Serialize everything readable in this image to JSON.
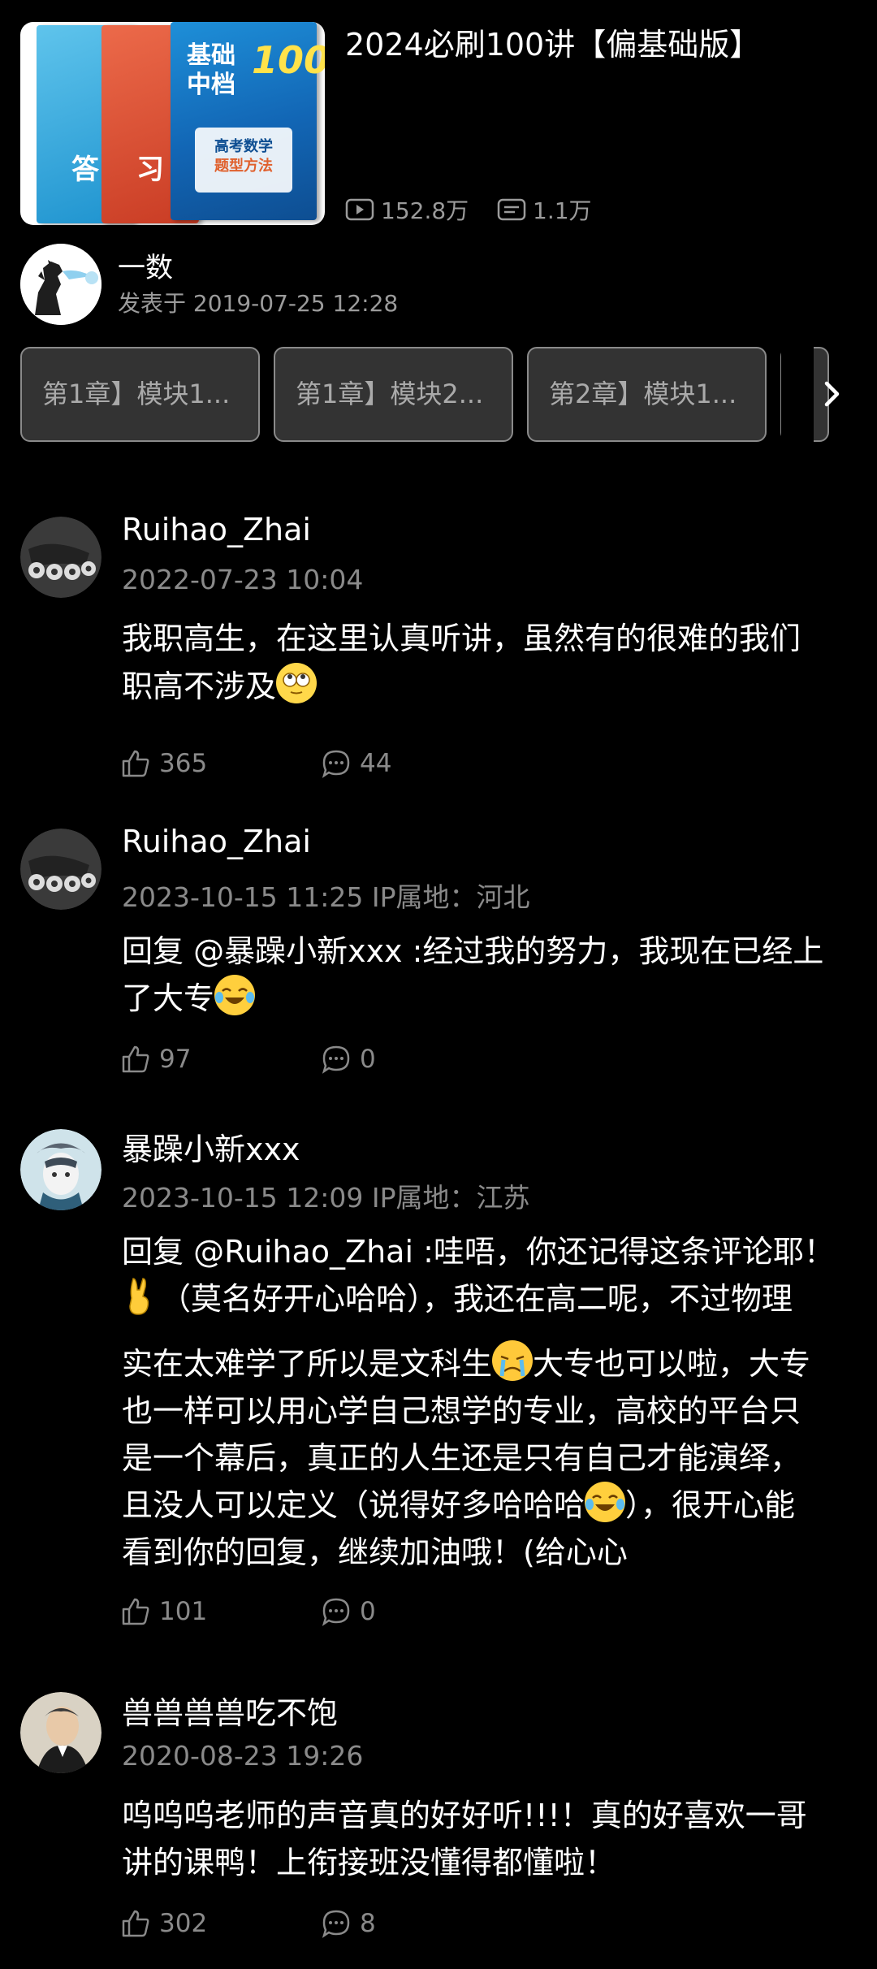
{
  "video": {
    "title": "2024必刷100讲【偏基础版】",
    "views": "152.8万",
    "danmaku": "1.1万",
    "cover_text": {
      "line1": "基础",
      "line2": "中档",
      "num": "100",
      "badge1": "高考数学",
      "badge2": "题型方法",
      "book2": "习",
      "book1": "答"
    }
  },
  "uploader": {
    "name": "一数",
    "published": "发表于 2019-07-25 12:28"
  },
  "chapters": [
    {
      "label": "第1章】模块1..."
    },
    {
      "label": "第1章】模块2..."
    },
    {
      "label": "第2章】模块1..."
    }
  ],
  "comments": [
    {
      "user": "Ruihao_Zhai",
      "meta": "2022-07-23 10:04",
      "text1": "我职高生，在这里认真听讲，虽然有的很难的我们",
      "text2": "职高不涉及",
      "likes": "365",
      "replies": "44"
    },
    {
      "user": "Ruihao_Zhai",
      "meta": "2023-10-15 11:25   IP属地：河北",
      "text1": "回复 @暴躁小新xxx :经过我的努力，我现在已经上",
      "text2": "了大专",
      "likes": "97",
      "replies": "0"
    },
    {
      "user": "暴躁小新xxx",
      "meta": "2023-10-15 12:09   IP属地：江苏",
      "text1": "回复 @Ruihao_Zhai :哇唔，你还记得这条评论耶！",
      "text2": "（莫名好开心哈哈），我还在高二呢，不过物理",
      "text3a": "实在太难学了所以是文科生",
      "text3b": "大专也可以啦，大专",
      "text4": "也一样可以用心学自己想学的专业，高校的平台只",
      "text5": "是一个幕后，真正的人生还是只有自己才能演绎，",
      "text6a": "且没人可以定义（说得好多哈哈哈",
      "text6b": "），很开心能",
      "text7": "看到你的回复，继续加油哦！(给心心",
      "likes": "101",
      "replies": "0"
    },
    {
      "user": "兽兽兽兽吃不饱",
      "meta": "2020-08-23 19:26",
      "text1": "呜呜呜老师的声音真的好好听!!!！真的好喜欢一哥",
      "text2": "讲的课鸭！上衔接班没懂得都懂啦！",
      "likes": "302",
      "replies": "8"
    }
  ]
}
